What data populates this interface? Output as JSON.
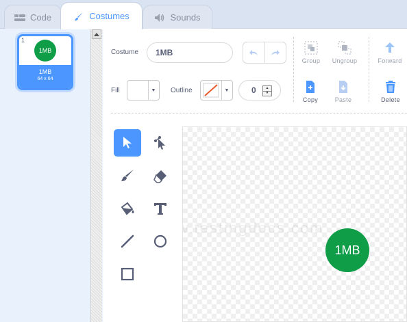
{
  "tabs": [
    {
      "label": "Code",
      "icon": "code-icon"
    },
    {
      "label": "Costumes",
      "icon": "paintbrush-icon"
    },
    {
      "label": "Sounds",
      "icon": "speaker-icon"
    }
  ],
  "costumes": [
    {
      "number": "1",
      "name": "1MB",
      "size": "64 x 64",
      "thumb_text": "1MB"
    }
  ],
  "toolbar": {
    "costume_label": "Costume",
    "costume_name": "1MB",
    "group": "Group",
    "ungroup": "Ungroup",
    "forward": "Forward",
    "copy": "Copy",
    "paste": "Paste",
    "delete": "Delete",
    "fill_label": "Fill",
    "outline_label": "Outline",
    "outline_width": "0"
  },
  "tools": [
    "select-tool",
    "reshape-tool",
    "brush-tool",
    "eraser-tool",
    "fill-tool",
    "text-tool",
    "line-tool",
    "circle-tool",
    "rectangle-tool"
  ],
  "canvas": {
    "sprite_text": "1MB",
    "watermark": "www.testingdocs.com"
  },
  "colors": {
    "accent": "#4c97ff",
    "sprite_green": "#0f9d48",
    "delete_blue": "#4c97ff"
  }
}
